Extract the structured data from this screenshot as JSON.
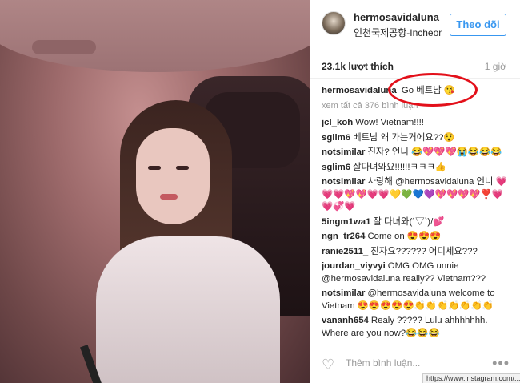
{
  "header": {
    "username": "hermosavidaluna",
    "location": "인천국제공항-Incheon...",
    "follow_label": "Theo dõi"
  },
  "stats": {
    "likes": "23.1k lượt thích",
    "time": "1 giờ"
  },
  "caption": {
    "user": "hermosavidaluna",
    "text": "Go 베트남 😘"
  },
  "view_all": "xem tất cả 376 bình luận",
  "comments": [
    {
      "user": "jcl_koh",
      "text": "Wow! Vietnam!!!!"
    },
    {
      "user": "sglim6",
      "text": "베트남 왜 가는거에요??😯"
    },
    {
      "user": "notsimilar",
      "text": "진자? 언니 😂💖💖💖😭😂😂😂"
    },
    {
      "user": "sglim6",
      "text": "잘다녀와요!!!!!!ㅋㅋㅋ👍"
    },
    {
      "user": "notsimilar",
      "text": "사랑해 @hermosavidaluna 언니 💗💗💗💖💖💗💗💛💚💙💜💖💖💖💖❣️💗💗💞💗"
    },
    {
      "user": "5ingm1wa1",
      "text": "잘 다녀와(´▽`)/💕"
    },
    {
      "user": "ngn_tr264",
      "text": "Come on 😍😍😍"
    },
    {
      "user": "ranie2511_",
      "text": "진자요?????? 어디세요???"
    },
    {
      "user": "jourdan_viyvyi",
      "text": "OMG OMG unnie @hermosavidaluna really?? Vietnam???"
    },
    {
      "user": "notsimilar",
      "text": "@hermosavidaluna welcome to Vietnam 😍😍😍😍😍👏👏👏👏👏👏👏"
    },
    {
      "user": "vananh654",
      "text": "Realy ????? Lulu ahhhhhhh. Where are you now?😂😂😂"
    }
  ],
  "footer": {
    "add_comment_placeholder": "Thêm bình luận...",
    "more_icon": "•••",
    "url_tooltip": "https://www.instagram.com/..."
  },
  "colors": {
    "accent": "#3897f0",
    "highlight": "#e3101a"
  }
}
